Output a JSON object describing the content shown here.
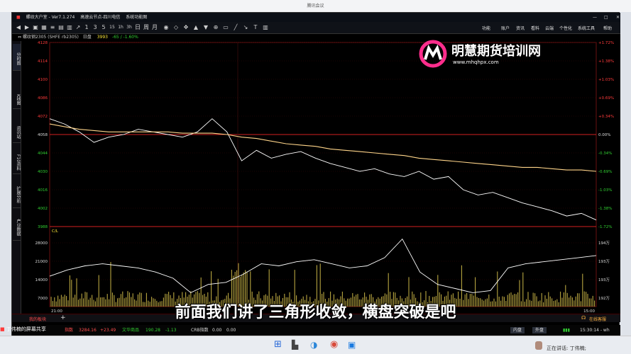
{
  "meeting_title": "腾讯会议",
  "app": {
    "title": "螺纹大户室 - Ver7.1.274",
    "server": "高速云节点-四川电信",
    "function": "系统功能图"
  },
  "menus": [
    "功能",
    "账户",
    "资讯",
    "看料",
    "云端",
    "个性化",
    "系统工具",
    "帮助"
  ],
  "info": {
    "instrument": "螺纹钢2305",
    "code": "(SHFE rb2305)",
    "period": "日盘",
    "price": "3993",
    "change": "-65 / -1.60%"
  },
  "side_tabs": [
    "分时图",
    "K线图",
    "资讯站",
    "F10资料",
    "扩展分析",
    "产业数据"
  ],
  "price_axis": {
    "left": [
      "4128",
      "4114",
      "4100",
      "4086",
      "4072",
      "4058",
      "4044",
      "4030",
      "4016",
      "4002",
      "3988"
    ],
    "right": [
      "+1.72%",
      "+1.38%",
      "+1.03%",
      "+0.69%",
      "+0.34%",
      "0.00%",
      "-0.34%",
      "-0.69%",
      "-1.03%",
      "-1.38%",
      "-1.72%"
    ]
  },
  "oi_axis": {
    "label": "C/L",
    "left": [
      "28000",
      "21000",
      "14000",
      "7000"
    ],
    "right": [
      "194万",
      "193万",
      "193万",
      "192万"
    ]
  },
  "time_axis": {
    "start": "21:00",
    "end": "15:00"
  },
  "logo": {
    "name": "明慧期货培训网",
    "url": "www.mhqhpx.com"
  },
  "subtitle": "前面我们讲了三角形收敛，横盘突破是吧",
  "bottombar": {
    "tab": "我的板块",
    "plus": "+",
    "status": "在线客服"
  },
  "statusbar": {
    "presenter": "丁伟楠的屏幕共享",
    "index1_label": "指数",
    "index1_value": "3284.16",
    "index1_change": "+23.49",
    "index2_label": "文华商品",
    "index2_value": "190.28",
    "index2_change": "-1.13",
    "index3_label": "CRB指数",
    "index3_value": "0.00",
    "index3_change": "0.00",
    "btn1": "内盘",
    "btn2": "外盘",
    "time": "15:30:14 - wh"
  },
  "taskbar": {
    "speaker": "正在讲话: 丁伟楠;"
  },
  "colors": {
    "price_line": "#ffffff",
    "avg_line": "#ffd58a",
    "ref_line": "#d21f1f",
    "axis_up": "#ff3b3b",
    "axis_down": "#32d232",
    "volume": "#b8a640"
  },
  "chart_data": {
    "type": "line",
    "x": [
      "21:00",
      "15:00"
    ],
    "ylim": [
      3988,
      4128
    ],
    "reference_price": 4058,
    "series": [
      {
        "values": [
          4070,
          4066,
          4060,
          4052,
          4056,
          4058,
          4062,
          4060,
          4058,
          4056,
          4060,
          4070,
          4060,
          4038,
          4046,
          4040,
          4043,
          4045,
          4040,
          4036,
          4033,
          4030,
          4032,
          4028,
          4026,
          4030,
          4024,
          4026,
          4016,
          4012,
          4014,
          4010,
          4006,
          4003,
          4000,
          3996,
          3998,
          3993
        ]
      },
      {
        "values": [
          4066,
          4064,
          4062,
          4061,
          4060,
          4060,
          4060,
          4060,
          4060,
          4059,
          4059,
          4059,
          4058,
          4056,
          4055,
          4053,
          4051,
          4050,
          4049,
          4047,
          4046,
          4045,
          4044,
          4043,
          4042,
          4040,
          4039,
          4038,
          4037,
          4036,
          4035,
          4034,
          4033,
          4033,
          4032,
          4031,
          4031,
          4030
        ]
      }
    ],
    "open_interest": [
      1930000,
      1933000,
      1935000,
      1936000,
      1935000,
      1934000,
      1932000,
      1929000,
      1922000,
      1926000,
      1927000,
      1931000,
      1936000,
      1935000,
      1937000,
      1938000,
      1936000,
      1934000,
      1935000,
      1939000,
      1948000,
      1932000,
      1926000,
      1924000,
      1922000,
      1923000,
      1934000,
      1936000,
      1937000,
      1938000,
      1939000,
      1940000
    ]
  }
}
